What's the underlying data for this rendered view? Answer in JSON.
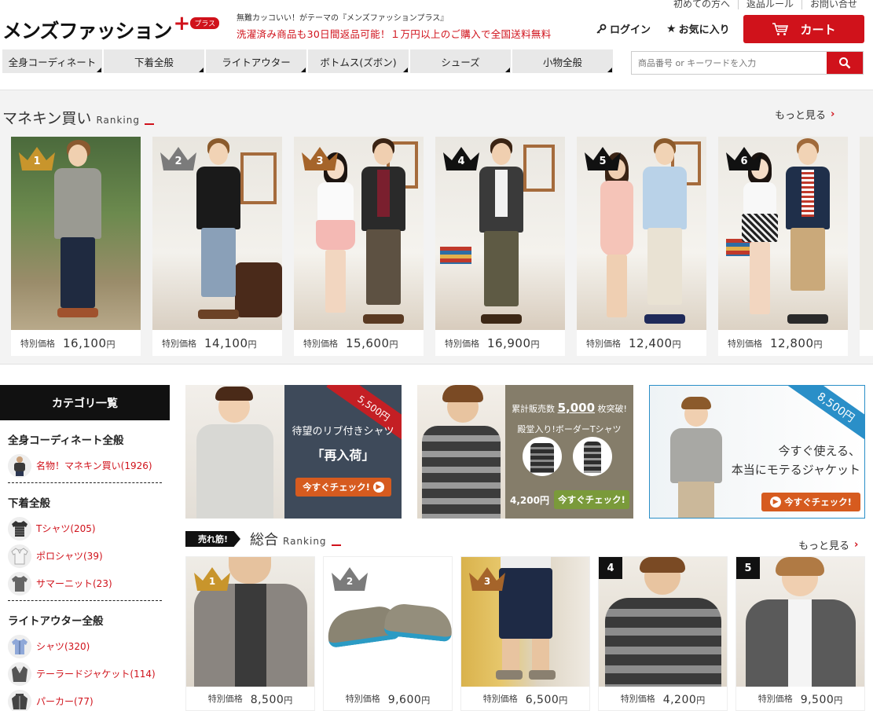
{
  "header": {
    "top_links": [
      "初めての方へ",
      "返品ルール",
      "お問い合せ"
    ],
    "logo_text": "メンズファッション",
    "logo_plus": "+",
    "logo_badge": "プラス",
    "tagline": "無難カッコいい！がテーマの『メンズファッションプラス』",
    "promo": "洗濯済み商品も30日間返品可能！１万円以上のご購入で全国送料無料",
    "login_label": "ログイン",
    "favorites_label": "お気に入り",
    "cart_label": "カート"
  },
  "nav": {
    "items": [
      {
        "label": "全身コーディネート"
      },
      {
        "label": "下着全般"
      },
      {
        "label": "ライトアウター"
      },
      {
        "label": "ボトムス(ズボン)"
      },
      {
        "label": "シューズ"
      },
      {
        "label": "小物全般"
      }
    ]
  },
  "search": {
    "placeholder": "商品番号 or キーワードを入力"
  },
  "mannequin_ranking": {
    "title": "マネキン買い",
    "title_en": "Ranking",
    "more_label": "もっと見る",
    "price_label": "特別価格",
    "yen": "円",
    "items": [
      {
        "rank": "1",
        "price": "16,100",
        "crown_color": "#c8952c"
      },
      {
        "rank": "2",
        "price": "14,100",
        "crown_color": "#7b7b7b"
      },
      {
        "rank": "3",
        "price": "15,600",
        "crown_color": "#a5642a"
      },
      {
        "rank": "4",
        "price": "16,900",
        "crown_color": "#111111"
      },
      {
        "rank": "5",
        "price": "12,400",
        "crown_color": "#111111"
      },
      {
        "rank": "6",
        "price": "12,800",
        "crown_color": "#111111"
      }
    ]
  },
  "sidebar": {
    "header": "カテゴリ一覧",
    "sections": [
      {
        "title": "全身コーディネート全般",
        "items": [
          {
            "label": "名物！マネキン買い(1926)"
          }
        ]
      },
      {
        "title": "下着全般",
        "items": [
          {
            "label": "Tシャツ(205)"
          },
          {
            "label": "ポロシャツ(39)"
          },
          {
            "label": "サマーニット(23)"
          }
        ]
      },
      {
        "title": "ライトアウター全般",
        "items": [
          {
            "label": "シャツ(320)"
          },
          {
            "label": "テーラードジャケット(114)"
          },
          {
            "label": "パーカー(77)"
          }
        ]
      }
    ]
  },
  "banners": {
    "shirt": {
      "ribbon": "5,500円",
      "line1": "待望のリブ付きシャツ",
      "line2": "「再入荷」",
      "button": "今すぐチェック!"
    },
    "border": {
      "line1_pre": "累計販売数",
      "line1_num": "5,000",
      "line1_post": "枚突破!",
      "line2": "殿堂入り!ボーダーTシャツ",
      "price": "4,200円",
      "button": "今すぐチェック!"
    },
    "jacket": {
      "ribbon": "8,500円",
      "line1": "今すぐ使える、",
      "line2": "本当にモテるジャケット",
      "button": "今すぐチェック!"
    }
  },
  "overall_ranking": {
    "badge": "売れ筋!",
    "title": "総合",
    "title_en": "Ranking",
    "more_label": "もっと見る",
    "price_label": "特別価格",
    "yen": "円",
    "items": [
      {
        "rank": "1",
        "price": "8,500",
        "crown_color": "#c8952c"
      },
      {
        "rank": "2",
        "price": "9,600",
        "crown_color": "#7b7b7b"
      },
      {
        "rank": "3",
        "price": "6,500",
        "crown_color": "#a5642a"
      },
      {
        "rank": "4",
        "price": "4,200"
      },
      {
        "rank": "5",
        "price": "9,500"
      }
    ]
  },
  "colors": {
    "accent": "#d0121b",
    "orange_button": "#d65b1f",
    "green_button": "#7a9a3a"
  }
}
